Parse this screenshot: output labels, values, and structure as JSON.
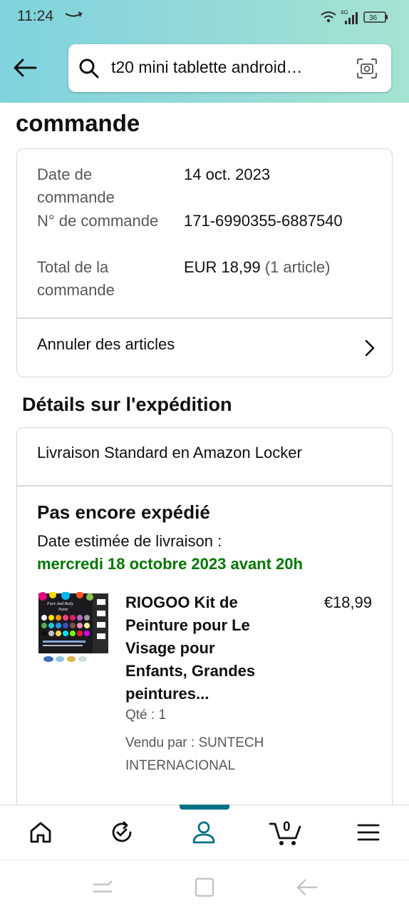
{
  "status_bar": {
    "time": "11:24",
    "network": "4G",
    "battery": "36"
  },
  "search": {
    "query": "t20 mini tablette android…"
  },
  "order": {
    "heading": "commande",
    "date_label": "Date de commande",
    "date_value": "14 oct. 2023",
    "number_label": "N° de commande",
    "number_value": "171-6990355-6887540",
    "total_label": "Total de la commande",
    "total_value": "EUR 18,99",
    "total_count": "(1 article)",
    "cancel_label": "Annuler des articles"
  },
  "shipping": {
    "heading": "Détails sur l'expédition",
    "delivery_type": "Livraison Standard en Amazon Locker",
    "status": "Pas encore expédié",
    "estimate_label": "Date estimée de livraison :",
    "estimate_date": "mercredi 18 octobre 2023 avant 20h",
    "item": {
      "title": "RIOGOO Kit de Peinture pour Le Visage pour Enfants, Grandes peintures...",
      "price": "€18,99",
      "qty": "Qté : 1",
      "seller": "Vendu par : SUNTECH INTERNACIONAL",
      "image_text": "Face And Body Paint"
    }
  },
  "bottom_nav": {
    "items": [
      "home-icon",
      "orders-icon",
      "account-icon",
      "cart-icon",
      "menu-icon"
    ],
    "cart_count": "0",
    "active_color": "#007185"
  },
  "colors": {
    "header_gradient_start": "#7fd3dd",
    "header_gradient_end": "#a6e3d2",
    "delivery_green": "#007600",
    "muted_text": "#565959",
    "border": "#d5d9d9"
  }
}
